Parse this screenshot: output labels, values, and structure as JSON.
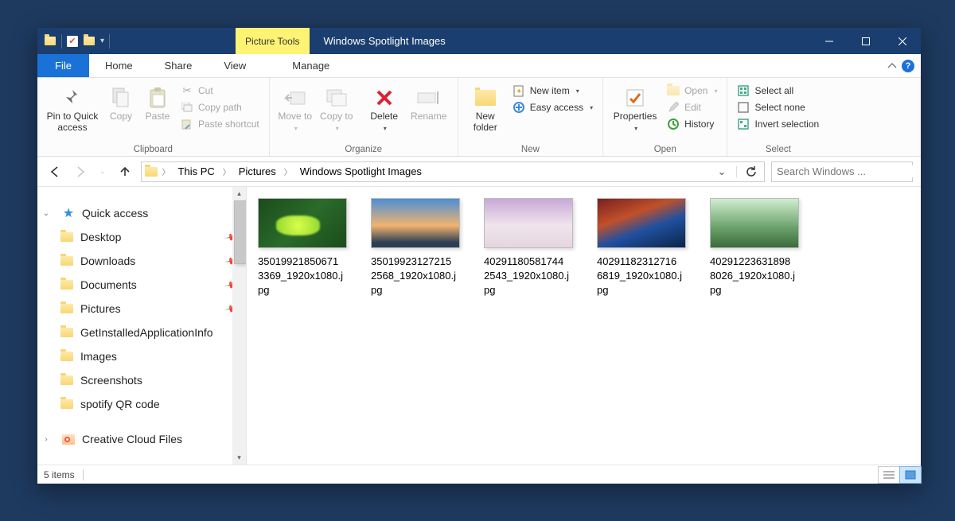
{
  "window": {
    "contextTab": "Picture Tools",
    "title": "Windows Spotlight Images"
  },
  "tabs": {
    "file": "File",
    "home": "Home",
    "share": "Share",
    "view": "View",
    "manage": "Manage"
  },
  "ribbon": {
    "clipboard": {
      "label": "Clipboard",
      "pin": "Pin to Quick access",
      "copy": "Copy",
      "paste": "Paste",
      "cut": "Cut",
      "copyPath": "Copy path",
      "pasteShortcut": "Paste shortcut"
    },
    "organize": {
      "label": "Organize",
      "moveTo": "Move to",
      "copyTo": "Copy to",
      "delete": "Delete",
      "rename": "Rename"
    },
    "new": {
      "label": "New",
      "newFolder": "New folder",
      "newItem": "New item",
      "easyAccess": "Easy access"
    },
    "open": {
      "label": "Open",
      "properties": "Properties",
      "open": "Open",
      "edit": "Edit",
      "history": "History"
    },
    "select": {
      "label": "Select",
      "selectAll": "Select all",
      "selectNone": "Select none",
      "invert": "Invert selection"
    }
  },
  "breadcrumbs": [
    "This PC",
    "Pictures",
    "Windows Spotlight Images"
  ],
  "search": {
    "placeholder": "Search Windows ..."
  },
  "nav": {
    "quickAccess": "Quick access",
    "pinned": [
      {
        "label": "Desktop"
      },
      {
        "label": "Downloads"
      },
      {
        "label": "Documents"
      },
      {
        "label": "Pictures"
      }
    ],
    "frequent": [
      "GetInstalledApplicationInfo",
      "Images",
      "Screenshots",
      "spotify QR code"
    ],
    "creativeCloud": "Creative Cloud Files"
  },
  "files": [
    {
      "name": "35019921850671\n3369_1920x1080.j\npg",
      "thumb": "t1"
    },
    {
      "name": "35019923127215\n2568_1920x1080.j\npg",
      "thumb": "t2"
    },
    {
      "name": "40291180581744\n2543_1920x1080.j\npg",
      "thumb": "t3"
    },
    {
      "name": "40291182312716\n6819_1920x1080.j\npg",
      "thumb": "t4"
    },
    {
      "name": "40291223631898\n8026_1920x1080.j\npg",
      "thumb": "t5"
    }
  ],
  "status": {
    "count": "5 items"
  }
}
